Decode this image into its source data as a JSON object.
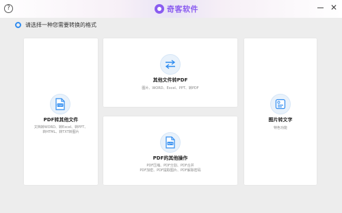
{
  "app": {
    "brand_name": "奇客软件",
    "help_glyph": "?",
    "close_glyph": "✕",
    "accent_color": "#2f8cf0",
    "brand_color": "#8a5cf0"
  },
  "prompt": {
    "text": "请选择一种您需要转换的格式"
  },
  "cards": {
    "pdf_to_other": {
      "title": "PDF转其他文件",
      "desc_line1": "文档转WORD、转Excel、转PPT、",
      "desc_line2": "转HTML、转TXT转图片",
      "icon": "pdf-document-icon"
    },
    "other_to_pdf": {
      "title": "其他文件转PDF",
      "desc_line1": "图片、WORD、Excel、PPT、转PDF",
      "icon": "convert-arrows-icon"
    },
    "pdf_ops": {
      "title": "PDF的其他操作",
      "desc_line1": "PDF压缩、PDF分割、PDF合并",
      "desc_line2": "PDF加密、PDF提取图片、PDF解除密码",
      "icon": "pdf-wps-document-icon"
    },
    "image_to_text": {
      "title": "图片转文字",
      "desc_line1": "特色功能",
      "icon": "ocr-image-icon"
    }
  }
}
